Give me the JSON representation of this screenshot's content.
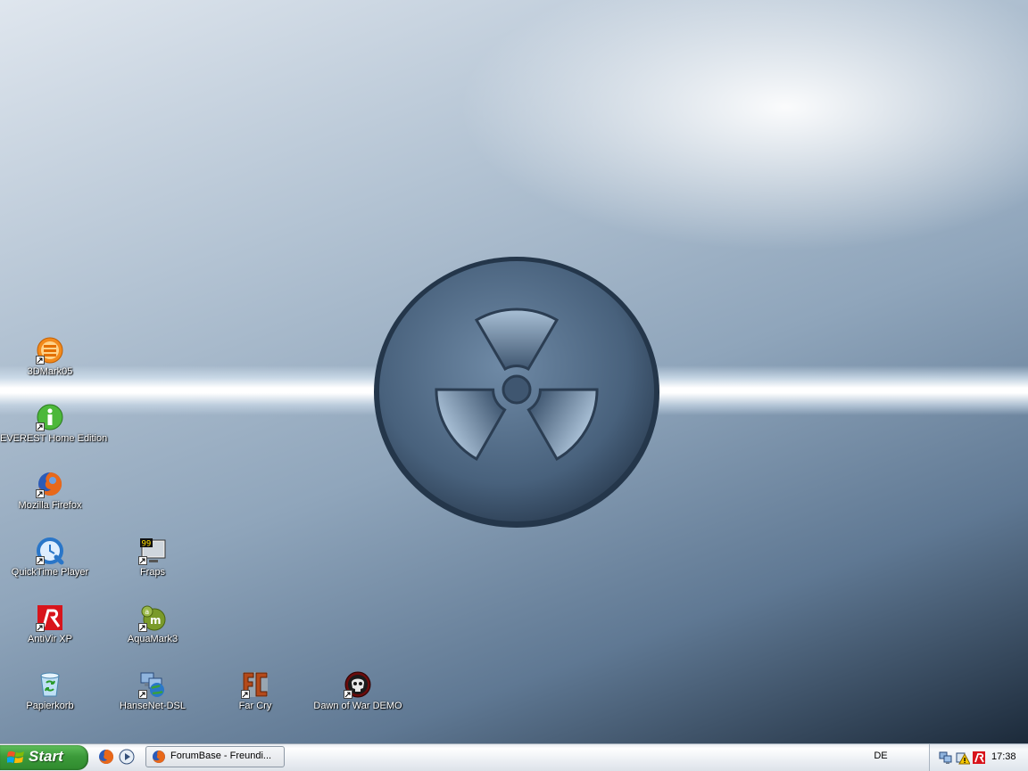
{
  "desktop": {
    "icons": [
      {
        "label": "3DMark05",
        "icon": "3dmark-icon"
      },
      {
        "label": "EVEREST Home Edition",
        "icon": "everest-info-icon"
      },
      {
        "label": "Mozilla Firefox",
        "icon": "firefox-icon"
      },
      {
        "label": "QuickTime Player",
        "icon": "quicktime-icon"
      },
      {
        "label": "Fraps",
        "icon": "fraps-icon"
      },
      {
        "label": "AntiVir XP",
        "icon": "antivir-icon"
      },
      {
        "label": "AquaMark3",
        "icon": "aquamark-icon"
      },
      {
        "label": "Papierkorb",
        "icon": "recycle-bin-icon"
      },
      {
        "label": "HanseNet-DSL",
        "icon": "network-connection-icon"
      },
      {
        "label": "Far Cry",
        "icon": "farcry-icon"
      },
      {
        "label": "Dawn of War DEMO",
        "icon": "dawn-of-war-icon"
      }
    ],
    "wallpaper": {
      "emblem": "radiation-symbol",
      "colors": {
        "steel": "#7f98b2",
        "dark": "#1c2a3a"
      }
    }
  },
  "taskbar": {
    "start_label": "Start",
    "quick_launch": [
      "firefox-icon",
      "media-player-icon"
    ],
    "tasks": [
      {
        "label": "ForumBase - Freundi...",
        "icon": "firefox-icon"
      }
    ],
    "language": "DE",
    "tray_icons": [
      "network-icon",
      "security-warning-icon",
      "antivir-tray-icon"
    ],
    "clock": "17:38",
    "colors": {
      "start_green": "#3c9a3a",
      "bar": "#eef1f5"
    }
  }
}
